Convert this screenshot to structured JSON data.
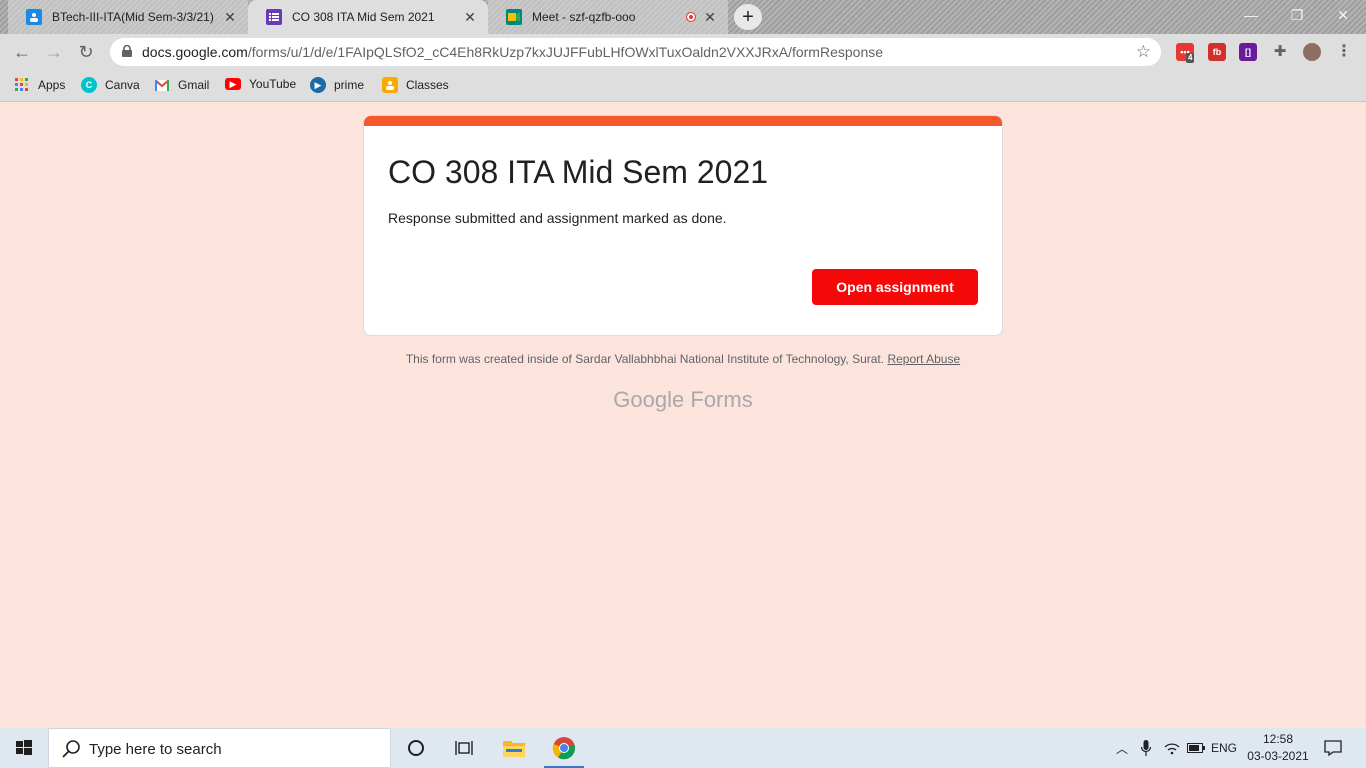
{
  "browser": {
    "tabs": [
      {
        "title": "BTech-III-ITA(Mid Sem-3/3/21)",
        "favicon": "classroom-icon",
        "color": "#1e88e5"
      },
      {
        "title": "CO 308 ITA Mid Sem 2021",
        "favicon": "forms-icon",
        "color": "#673ab7"
      },
      {
        "title": "Meet - szf-qzfb-ooo",
        "favicon": "meet-icon",
        "color": "#00897b"
      }
    ],
    "url_host": "docs.google.com",
    "url_path": "/forms/u/1/d/e/1FAIpQLSfO2_cC4Eh8RkUzp7kxJUJFFubLHfOWxlTuxOaldn2VXXJRxA/formResponse",
    "extension_badge": "4",
    "window_controls": [
      "minimize",
      "restore",
      "close"
    ]
  },
  "bookmarks": [
    {
      "label": "Apps",
      "icon": "apps-grid-icon"
    },
    {
      "label": "Canva",
      "icon": "canva-icon",
      "color": "#00c4cc"
    },
    {
      "label": "Gmail",
      "icon": "gmail-icon",
      "color": "#ea4335"
    },
    {
      "label": "YouTube",
      "icon": "youtube-icon",
      "color": "#ff0000"
    },
    {
      "label": "prime",
      "icon": "prime-video-icon",
      "color": "#1a98ff"
    },
    {
      "label": "Classes",
      "icon": "classroom-icon",
      "color": "#f9ab00"
    }
  ],
  "form": {
    "title": "CO 308 ITA Mid Sem 2021",
    "confirmation": "Response submitted and assignment marked as done.",
    "open_button": "Open assignment",
    "footer_note": "This form was created inside of Sardar Vallabhbhai National Institute of Technology, Surat.",
    "report_abuse": "Report Abuse",
    "brand_google": "Google",
    "brand_forms": "Forms",
    "accent_color": "#f4582b",
    "button_color": "#f60808",
    "background_color": "#fce4dc"
  },
  "taskbar": {
    "search_placeholder": "Type here to search",
    "language": "ENG",
    "time": "12:58",
    "date": "03-03-2021"
  }
}
